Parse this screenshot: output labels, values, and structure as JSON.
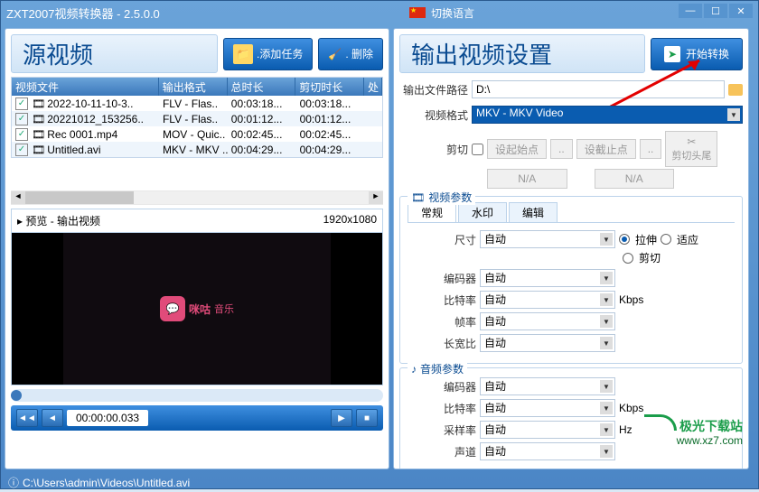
{
  "app": {
    "title": "ZXT2007视频转换器 - 2.5.0.0",
    "lang_switch": "切换语言"
  },
  "left": {
    "title": "源视频",
    "add_task": ".添加任务",
    "delete": ". 删除",
    "columns": {
      "file": "视频文件",
      "outfmt": "输出格式",
      "duration": "总时长",
      "cut": "剪切时长",
      "proc": "处"
    },
    "rows": [
      {
        "file": "2022-10-11-10-3..",
        "fmt": "FLV - Flas..",
        "dur": "00:03:18...",
        "cut": "00:03:18..."
      },
      {
        "file": "20221012_153256..",
        "fmt": "FLV - Flas..",
        "dur": "00:01:12...",
        "cut": "00:01:12..."
      },
      {
        "file": "Rec 0001.mp4",
        "fmt": "MOV - Quic..",
        "dur": "00:02:45...",
        "cut": "00:02:45..."
      },
      {
        "file": "Untitled.avi",
        "fmt": "MKV - MKV ..",
        "dur": "00:04:29...",
        "cut": "00:04:29..."
      }
    ],
    "preview_label": "▸ 预览 - 输出视频",
    "preview_res": "1920x1080",
    "logo_text": "咪咕",
    "logo_suffix": "音乐",
    "time": "00:00:00.033"
  },
  "status": {
    "path": "C:\\Users\\admin\\Videos\\Untitled.avi"
  },
  "right": {
    "title": "输出视频设置",
    "start": "开始转换",
    "out_path_label": "输出文件路径",
    "out_path": "D:\\",
    "video_fmt_label": "视频格式",
    "video_fmt": "MKV - MKV Video",
    "cut_label": "剪切",
    "set_start": "设起始点",
    "set_end": "设截止点",
    "na": "N/A",
    "cut_btn": "剪切头尾",
    "video_params": "视频参数",
    "audio_params": "音频参数",
    "tabs": {
      "general": "常规",
      "watermark": "水印",
      "edit": "编辑"
    },
    "size": "尺寸",
    "encoder": "编码器",
    "bitrate": "比特率",
    "fps": "帧率",
    "aspect": "长宽比",
    "sample": "采样率",
    "channel": "声道",
    "auto": "自动",
    "stretch": "拉伸",
    "fit": "适应",
    "crop": "剪切",
    "kbps": "Kbps",
    "hz": "Hz"
  },
  "watermark": {
    "brand": "极光下载站",
    "url": "www.xz7.com"
  }
}
